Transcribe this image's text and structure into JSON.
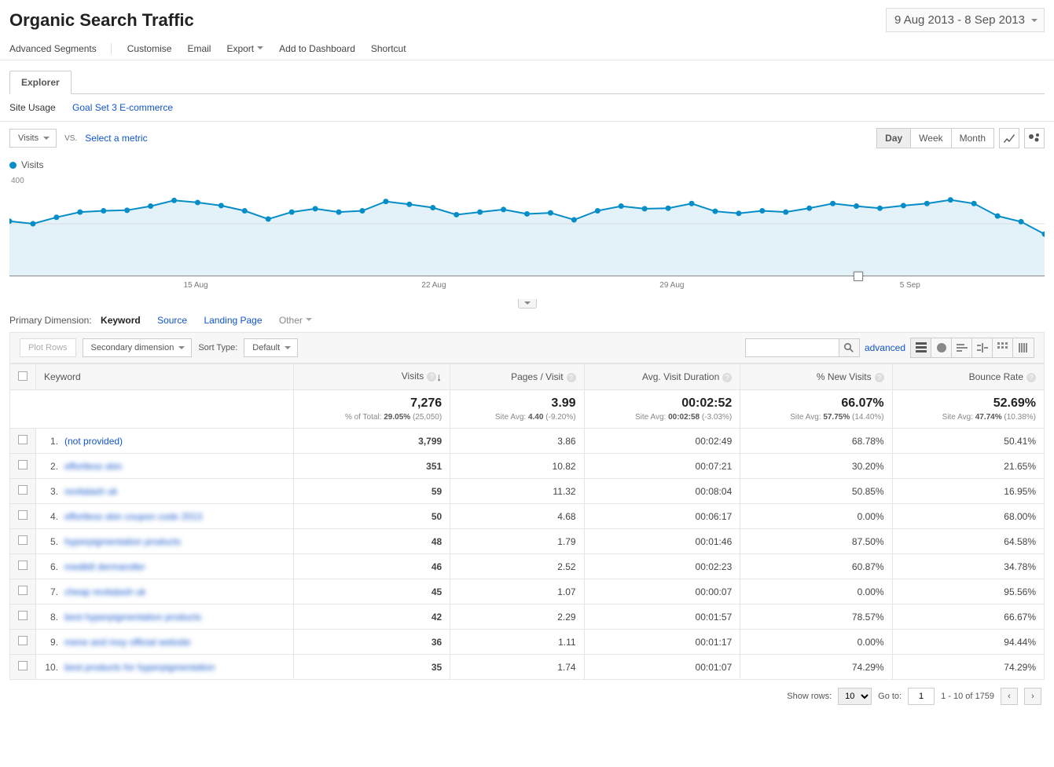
{
  "page_title": "Organic Search Traffic",
  "date_range": "9 Aug 2013 - 8 Sep 2013",
  "toolbar": {
    "segments": "Advanced Segments",
    "customise": "Customise",
    "email": "Email",
    "export": "Export",
    "add_dashboard": "Add to Dashboard",
    "shortcut": "Shortcut"
  },
  "tab": "Explorer",
  "subtabs": {
    "site_usage": "Site Usage",
    "goal_set": "Goal Set 3",
    "ecommerce": "E-commerce"
  },
  "metrics": {
    "primary": "Visits",
    "vs": "VS.",
    "select": "Select a metric",
    "day": "Day",
    "week": "Week",
    "month": "Month"
  },
  "legend": "Visits",
  "chart_data": {
    "type": "line",
    "ylabel": "Visits",
    "ylim": [
      0,
      400
    ],
    "yticks": [
      200,
      400
    ],
    "x_ticks": [
      "15 Aug",
      "22 Aug",
      "29 Aug",
      "5 Sep"
    ],
    "series": [
      {
        "name": "Visits",
        "color": "#058dc7",
        "values": [
          210,
          200,
          225,
          245,
          250,
          252,
          268,
          290,
          282,
          270,
          250,
          218,
          245,
          258,
          245,
          250,
          286,
          275,
          262,
          235,
          245,
          255,
          238,
          242,
          215,
          250,
          268,
          258,
          260,
          278,
          248,
          240,
          250,
          245,
          260,
          278,
          268,
          260,
          270,
          278,
          292,
          278,
          230,
          208,
          160
        ]
      }
    ]
  },
  "dimensions": {
    "label": "Primary Dimension:",
    "keyword": "Keyword",
    "source": "Source",
    "landing": "Landing Page",
    "other": "Other"
  },
  "tabletoolbar": {
    "plot_rows": "Plot Rows",
    "secondary": "Secondary dimension",
    "sort_label": "Sort Type:",
    "sort_default": "Default",
    "advanced": "advanced"
  },
  "columns": {
    "keyword": "Keyword",
    "visits": "Visits",
    "pages": "Pages / Visit",
    "duration": "Avg. Visit Duration",
    "newvisits": "% New Visits",
    "bounce": "Bounce Rate"
  },
  "summary": {
    "visits": {
      "big": "7,276",
      "sub_pre": "% of Total: ",
      "sub_b": "29.05%",
      "sub_post": " (25,050)"
    },
    "pages": {
      "big": "3.99",
      "sub_pre": "Site Avg: ",
      "sub_b": "4.40",
      "sub_post": " (-9.20%)"
    },
    "duration": {
      "big": "00:02:52",
      "sub_pre": "Site Avg: ",
      "sub_b": "00:02:58",
      "sub_post": " (-3.03%)"
    },
    "newvisits": {
      "big": "66.07%",
      "sub_pre": "Site Avg: ",
      "sub_b": "57.75%",
      "sub_post": " (14.40%)"
    },
    "bounce": {
      "big": "52.69%",
      "sub_pre": "Site Avg: ",
      "sub_b": "47.74%",
      "sub_post": " (10.38%)"
    }
  },
  "rows": [
    {
      "idx": "1.",
      "kw": "(not provided)",
      "blurred": false,
      "visits": "3,799",
      "pages": "3.86",
      "dur": "00:02:49",
      "new": "68.78%",
      "bounce": "50.41%"
    },
    {
      "idx": "2.",
      "kw": "effortless skin",
      "blurred": true,
      "visits": "351",
      "pages": "10.82",
      "dur": "00:07:21",
      "new": "30.20%",
      "bounce": "21.65%"
    },
    {
      "idx": "3.",
      "kw": "revitalash uk",
      "blurred": true,
      "visits": "59",
      "pages": "11.32",
      "dur": "00:08:04",
      "new": "50.85%",
      "bounce": "16.95%"
    },
    {
      "idx": "4.",
      "kw": "effortless skin coupon code 2013",
      "blurred": true,
      "visits": "50",
      "pages": "4.68",
      "dur": "00:06:17",
      "new": "0.00%",
      "bounce": "68.00%"
    },
    {
      "idx": "5.",
      "kw": "hyperpigmentation products",
      "blurred": true,
      "visits": "48",
      "pages": "1.79",
      "dur": "00:01:46",
      "new": "87.50%",
      "bounce": "64.58%"
    },
    {
      "idx": "6.",
      "kw": "medik8 dermaroller",
      "blurred": true,
      "visits": "46",
      "pages": "2.52",
      "dur": "00:02:23",
      "new": "60.87%",
      "bounce": "34.78%"
    },
    {
      "idx": "7.",
      "kw": "cheap revitalash uk",
      "blurred": true,
      "visits": "45",
      "pages": "1.07",
      "dur": "00:00:07",
      "new": "0.00%",
      "bounce": "95.56%"
    },
    {
      "idx": "8.",
      "kw": "best hyperpigmentation products",
      "blurred": true,
      "visits": "42",
      "pages": "2.29",
      "dur": "00:01:57",
      "new": "78.57%",
      "bounce": "66.67%"
    },
    {
      "idx": "9.",
      "kw": "mene and moy official website",
      "blurred": true,
      "visits": "36",
      "pages": "1.11",
      "dur": "00:01:17",
      "new": "0.00%",
      "bounce": "94.44%"
    },
    {
      "idx": "10.",
      "kw": "best products for hyperpigmentation",
      "blurred": true,
      "visits": "35",
      "pages": "1.74",
      "dur": "00:01:07",
      "new": "74.29%",
      "bounce": "74.29%"
    }
  ],
  "pager": {
    "show_rows": "Show rows:",
    "rows_value": "10",
    "goto": "Go to:",
    "goto_value": "1",
    "range": "1 - 10 of 1759"
  }
}
